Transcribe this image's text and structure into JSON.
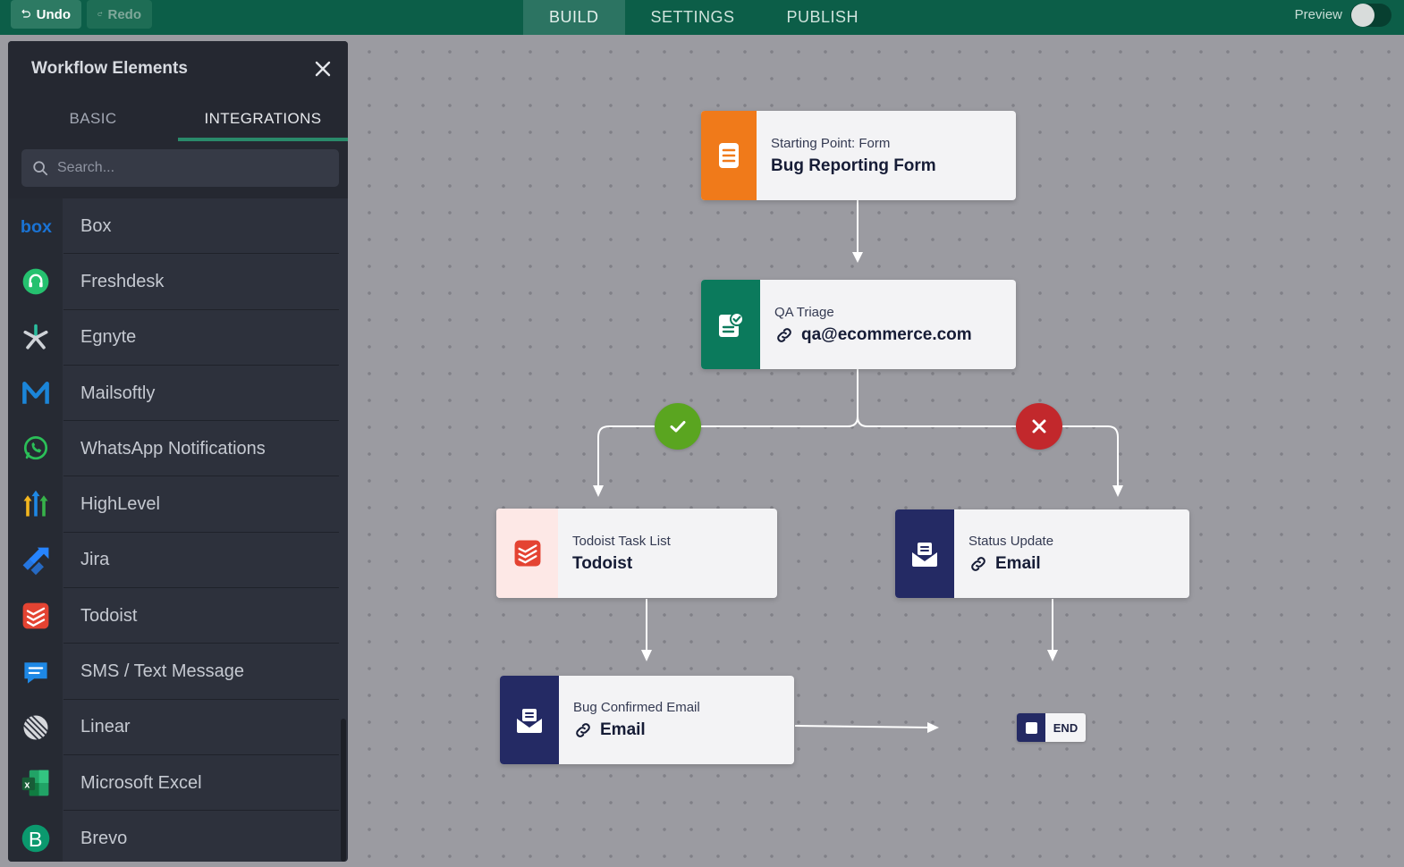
{
  "topbar": {
    "undo_label": "Undo",
    "redo_label": "Redo",
    "tabs": [
      "BUILD",
      "SETTINGS",
      "PUBLISH"
    ],
    "active_tab": "BUILD",
    "preview_label": "Preview"
  },
  "sidebar": {
    "title": "Workflow Elements",
    "tabs": [
      "BASIC",
      "INTEGRATIONS"
    ],
    "active_tab": "INTEGRATIONS",
    "search_placeholder": "Search...",
    "items": [
      {
        "label": "Box",
        "icon": "box-logo-icon"
      },
      {
        "label": "Freshdesk",
        "icon": "freshdesk-headset-icon"
      },
      {
        "label": "Egnyte",
        "icon": "egnyte-logo-icon"
      },
      {
        "label": "Mailsoftly",
        "icon": "mailsoftly-m-icon"
      },
      {
        "label": "WhatsApp Notifications",
        "icon": "whatsapp-icon"
      },
      {
        "label": "HighLevel",
        "icon": "highlevel-arrows-icon"
      },
      {
        "label": "Jira",
        "icon": "jira-logo-icon"
      },
      {
        "label": "Todoist",
        "icon": "todoist-logo-icon"
      },
      {
        "label": "SMS / Text Message",
        "icon": "sms-chat-icon"
      },
      {
        "label": "Linear",
        "icon": "linear-logo-icon"
      },
      {
        "label": "Microsoft Excel",
        "icon": "excel-logo-icon"
      },
      {
        "label": "Brevo",
        "icon": "brevo-b-icon"
      }
    ]
  },
  "flow": {
    "start": {
      "subtitle": "Starting Point: Form",
      "title": "Bug Reporting Form",
      "icon": "form-document-icon",
      "color": "#f07a1a"
    },
    "triage": {
      "subtitle": "QA Triage",
      "title": "qa@ecommerce.com",
      "icon": "approval-check-icon",
      "color": "#0b7a5c"
    },
    "approved_badge": {
      "icon": "checkmark-icon",
      "color": "#5aa520"
    },
    "rejected_badge": {
      "icon": "close-icon",
      "color": "#c2282c"
    },
    "todoist": {
      "subtitle": "Todoist Task List",
      "title": "Todoist",
      "icon": "todoist-logo-icon",
      "color": "#e44332"
    },
    "status": {
      "subtitle": "Status Update",
      "title": "Email",
      "icon": "email-envelope-icon",
      "color": "#242a64"
    },
    "confirmed": {
      "subtitle": "Bug Confirmed Email",
      "title": "Email",
      "icon": "email-envelope-icon",
      "color": "#242a64"
    },
    "end_label": "END"
  }
}
